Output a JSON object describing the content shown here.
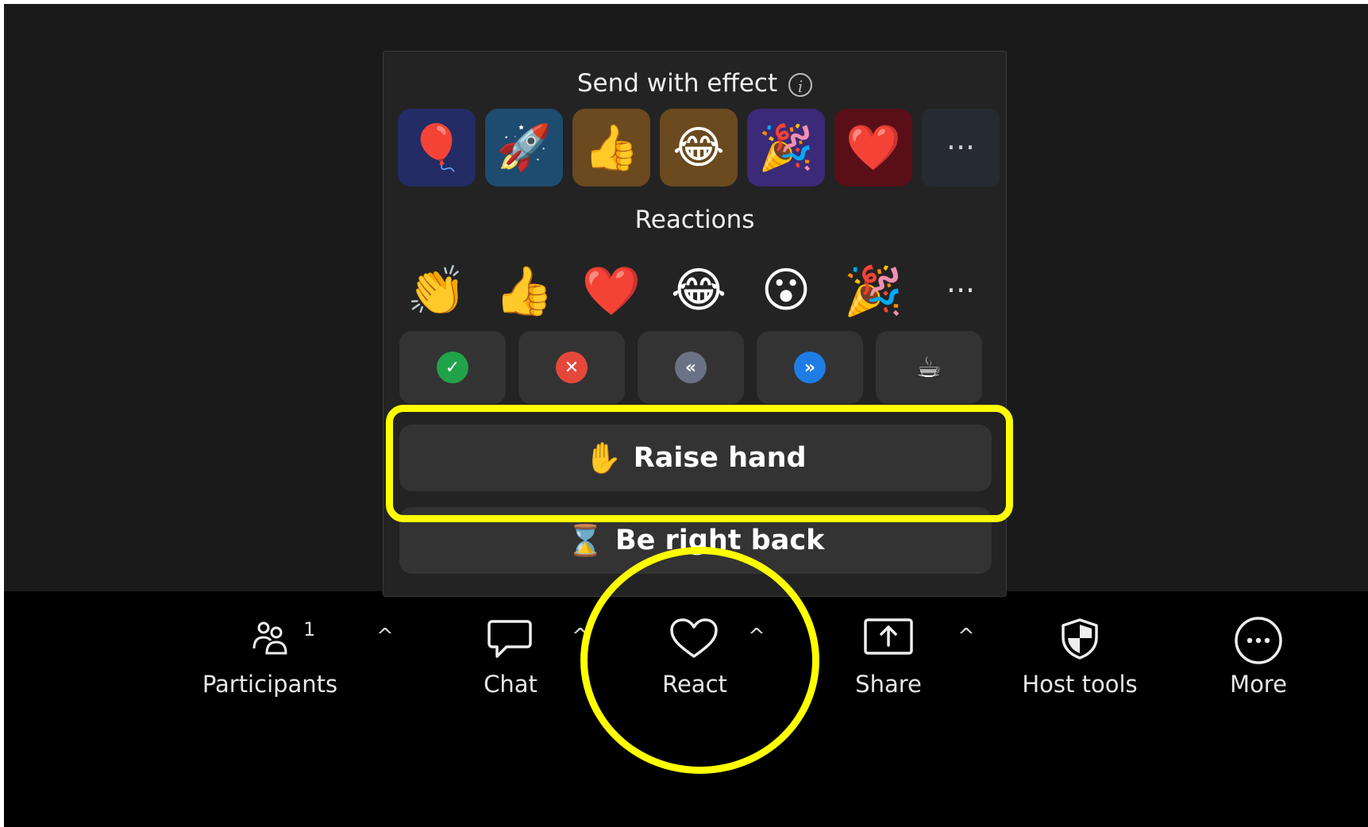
{
  "popup": {
    "effects_title": "Send with effect",
    "effects": [
      {
        "icon": "balloon-icon",
        "glyph": "🎈",
        "bg": "#232c64"
      },
      {
        "icon": "rocket-icon",
        "glyph": "🚀",
        "bg": "#1e4c70"
      },
      {
        "icon": "thumbs-up-icon",
        "glyph": "👍",
        "bg": "#6a4a1e"
      },
      {
        "icon": "laughing-icon",
        "glyph": "😂",
        "bg": "#6a4a1e"
      },
      {
        "icon": "party-popper-icon",
        "glyph": "🎉",
        "bg": "#3b2a78"
      },
      {
        "icon": "heart-icon",
        "glyph": "❤️",
        "bg": "#5a0f18"
      }
    ],
    "effects_more": "···",
    "reactions_title": "Reactions",
    "reactions": [
      {
        "icon": "clapping-hands-icon",
        "glyph": "👏"
      },
      {
        "icon": "thumbs-up-icon",
        "glyph": "👍"
      },
      {
        "icon": "heart-icon",
        "glyph": "❤️"
      },
      {
        "icon": "laughing-icon",
        "glyph": "😂"
      },
      {
        "icon": "surprised-face-icon",
        "glyph": "😮"
      },
      {
        "icon": "party-popper-icon",
        "glyph": "🎉"
      }
    ],
    "reactions_more": "···",
    "status": [
      {
        "icon": "yes-check-icon",
        "glyph": "✓",
        "color": "#21a34a"
      },
      {
        "icon": "no-x-icon",
        "glyph": "✕",
        "color": "#e5483b"
      },
      {
        "icon": "slow-down-icon",
        "glyph": "«",
        "color": "#6b7285"
      },
      {
        "icon": "speed-up-icon",
        "glyph": "»",
        "color": "#1e7de4"
      },
      {
        "icon": "coffee-icon",
        "glyph": "☕",
        "color": "transparent"
      }
    ],
    "raise_hand": {
      "glyph": "✋",
      "label": "Raise hand"
    },
    "be_right_back": {
      "glyph": "⌛",
      "label": "Be right back"
    }
  },
  "toolbar": {
    "participants": {
      "label": "Participants",
      "count": "1"
    },
    "chat": {
      "label": "Chat"
    },
    "react": {
      "label": "React"
    },
    "share": {
      "label": "Share"
    },
    "host_tools": {
      "label": "Host tools"
    },
    "more": {
      "label": "More"
    },
    "caret": "^"
  },
  "colors": {
    "highlight": "#ffff00",
    "popup_bg": "#232323",
    "button_bg": "#333333"
  }
}
